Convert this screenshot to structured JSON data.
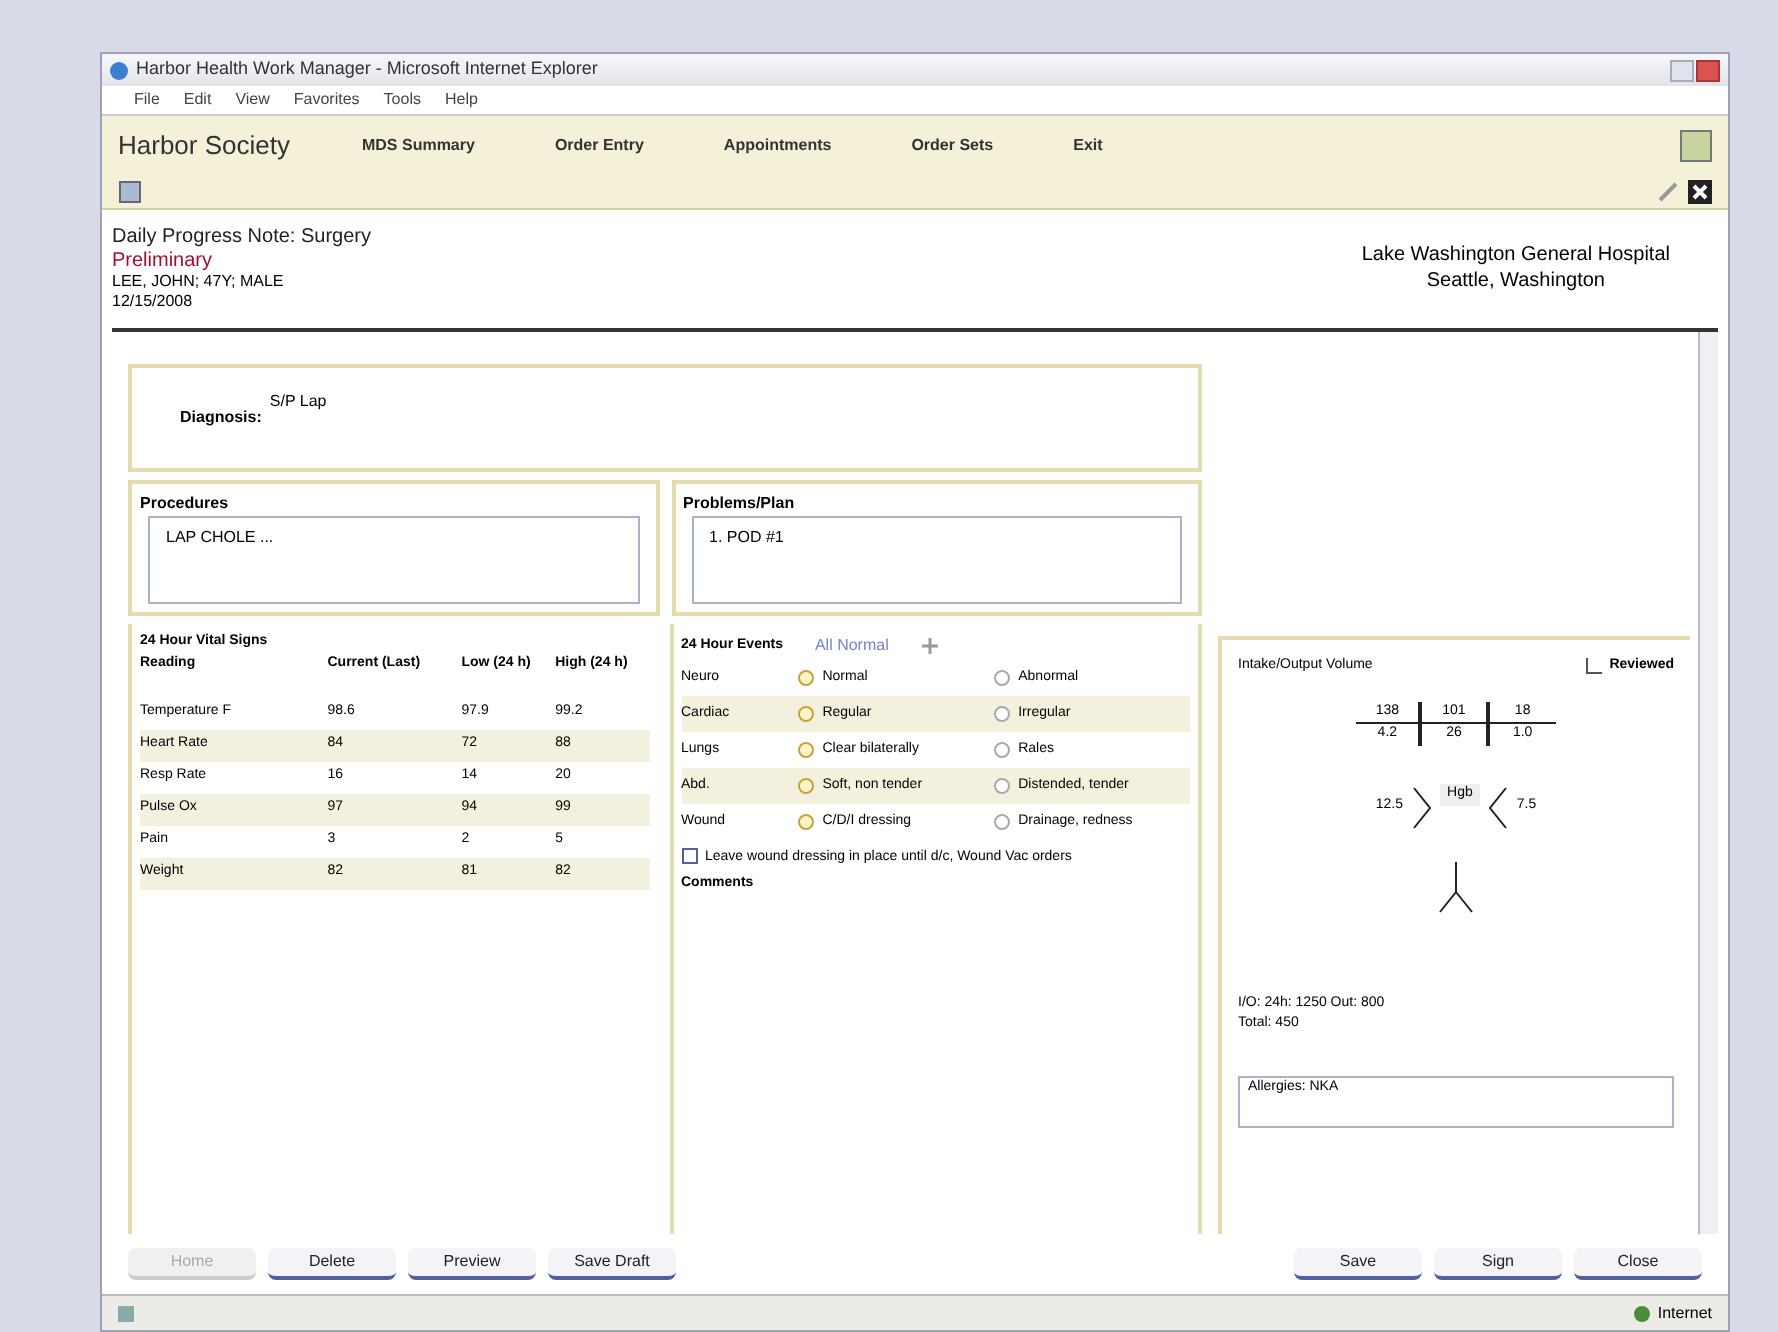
{
  "window": {
    "title": "Harbor Health Work Manager - Microsoft Internet Explorer"
  },
  "menu": [
    "File",
    "Edit",
    "View",
    "Favorites",
    "Tools",
    "Help"
  ],
  "app": {
    "name": "Harbor Society",
    "nav": [
      "MDS Summary",
      "Order Entry",
      "Appointments",
      "Order Sets",
      "Exit"
    ]
  },
  "note": {
    "title": "Daily Progress Note: Surgery",
    "status": "Preliminary",
    "patient": "LEE, JOHN; 47Y; MALE",
    "date": "12/15/2008",
    "hospital": "Lake Washington General Hospital",
    "city": "Seattle, Washington"
  },
  "diagnosis": {
    "label": "Diagnosis:",
    "value": "S/P Lap"
  },
  "procedures": {
    "label": "Procedures",
    "value": "LAP CHOLE ..."
  },
  "problems": {
    "label": "Problems/Plan",
    "value": "1. POD #1"
  },
  "vitals": {
    "title": "24 Hour Vital Signs",
    "columns": [
      "Reading",
      "Current (Last)",
      "Low (24 h)",
      "High (24 h)"
    ],
    "rows": [
      [
        "Temperature F",
        "98.6",
        "97.9",
        "99.2"
      ],
      [
        "Heart Rate",
        "84",
        "72",
        "88"
      ],
      [
        "Resp Rate",
        "16",
        "14",
        "20"
      ],
      [
        "Pulse Ox",
        "97",
        "94",
        "99"
      ],
      [
        "Pain",
        "3",
        "2",
        "5"
      ],
      [
        "Weight",
        "82",
        "81",
        "82"
      ]
    ]
  },
  "exam": {
    "title": "24 Hour Events",
    "all_normal": "All Normal",
    "rows": [
      {
        "label": "Neuro",
        "options": [
          {
            "text": "Normal",
            "selected": true
          },
          {
            "text": "Abnormal",
            "selected": false
          }
        ]
      },
      {
        "label": "Cardiac",
        "options": [
          {
            "text": "Regular",
            "selected": true
          },
          {
            "text": "Irregular",
            "selected": false
          }
        ]
      },
      {
        "label": "Lungs",
        "options": [
          {
            "text": "Clear bilaterally",
            "selected": true
          },
          {
            "text": "Rales",
            "selected": false
          }
        ]
      },
      {
        "label": "Abd.",
        "options": [
          {
            "text": "Soft, non tender",
            "selected": true
          },
          {
            "text": "Distended, tender",
            "selected": false
          }
        ]
      },
      {
        "label": "Wound",
        "options": [
          {
            "text": "C/D/I dressing",
            "selected": true
          },
          {
            "text": "Drainage, redness",
            "selected": false
          }
        ]
      }
    ],
    "checkbox": {
      "text": "Leave wound dressing in place until d/c, Wound Vac orders",
      "checked": false
    },
    "comments": "Comments"
  },
  "labs": {
    "title": "Intake/Output Volume",
    "reviewed": {
      "text": "Reviewed",
      "checked": false
    },
    "bmp": [
      "138",
      "101",
      "18",
      "4.2",
      "26",
      "1.0"
    ],
    "cbc": [
      "12.5",
      "Hgb",
      "7.5"
    ],
    "io": "I/O: 24h: 1250  Out: 800",
    "total": "Total: 450",
    "allergies": "Allergies: NKA"
  },
  "buttons_left": [
    {
      "label": "Home",
      "disabled": true
    },
    {
      "label": "Delete",
      "disabled": false
    },
    {
      "label": "Preview",
      "disabled": false
    },
    {
      "label": "Save Draft",
      "disabled": false
    }
  ],
  "buttons_right": [
    {
      "label": "Save",
      "disabled": false
    },
    {
      "label": "Sign",
      "disabled": false
    },
    {
      "label": "Close",
      "disabled": false
    }
  ],
  "status_bar": {
    "zone": "Internet"
  }
}
